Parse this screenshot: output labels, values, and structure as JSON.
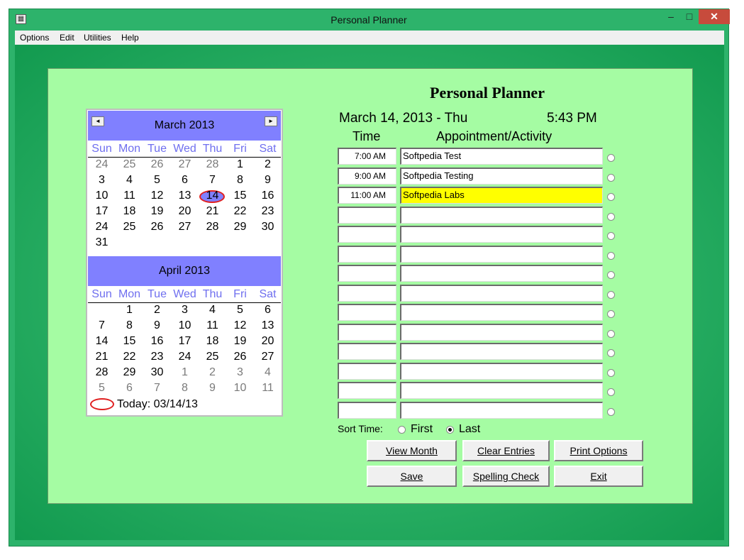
{
  "window": {
    "title": "Personal Planner",
    "icon": "planner-app-icon"
  },
  "menu": [
    "Options",
    "Edit",
    "Utilities",
    "Help"
  ],
  "planner": {
    "heading": "Personal Planner",
    "date": "March 14, 2013 - Thu",
    "time": "5:43 PM",
    "time_header": "Time",
    "activity_header": "Appointment/Activity"
  },
  "calendars": [
    {
      "title": "March 2013",
      "days_of_week": [
        "Sun",
        "Mon",
        "Tue",
        "Wed",
        "Thu",
        "Fri",
        "Sat"
      ],
      "weeks": [
        [
          "24",
          "25",
          "26",
          "27",
          "28",
          "1",
          "2"
        ],
        [
          "3",
          "4",
          "5",
          "6",
          "7",
          "8",
          "9"
        ],
        [
          "10",
          "11",
          "12",
          "13",
          "14",
          "15",
          "16"
        ],
        [
          "17",
          "18",
          "19",
          "20",
          "21",
          "22",
          "23"
        ],
        [
          "24",
          "25",
          "26",
          "27",
          "28",
          "29",
          "30"
        ],
        [
          "31",
          "",
          "",
          "",
          "",
          "",
          ""
        ]
      ],
      "selected_day": "14"
    },
    {
      "title": "April 2013",
      "days_of_week": [
        "Sun",
        "Mon",
        "Tue",
        "Wed",
        "Thu",
        "Fri",
        "Sat"
      ],
      "weeks": [
        [
          "",
          "1",
          "2",
          "3",
          "4",
          "5",
          "6"
        ],
        [
          "7",
          "8",
          "9",
          "10",
          "11",
          "12",
          "13"
        ],
        [
          "14",
          "15",
          "16",
          "17",
          "18",
          "19",
          "20"
        ],
        [
          "21",
          "22",
          "23",
          "24",
          "25",
          "26",
          "27"
        ],
        [
          "28",
          "29",
          "30",
          "1",
          "2",
          "3",
          "4"
        ],
        [
          "5",
          "6",
          "7",
          "8",
          "9",
          "10",
          "11"
        ]
      ]
    }
  ],
  "today_label": "Today: 03/14/13",
  "appointments": [
    {
      "time": "7:00 AM",
      "activity": "Softpedia Test",
      "highlight": false
    },
    {
      "time": "9:00 AM",
      "activity": "Softpedia Testing",
      "highlight": false
    },
    {
      "time": "11:00 AM",
      "activity": "Softpedia Labs",
      "highlight": true
    },
    {
      "time": "",
      "activity": "",
      "highlight": false
    },
    {
      "time": "",
      "activity": "",
      "highlight": false
    },
    {
      "time": "",
      "activity": "",
      "highlight": false
    },
    {
      "time": "",
      "activity": "",
      "highlight": false
    },
    {
      "time": "",
      "activity": "",
      "highlight": false
    },
    {
      "time": "",
      "activity": "",
      "highlight": false
    },
    {
      "time": "",
      "activity": "",
      "highlight": false
    },
    {
      "time": "",
      "activity": "",
      "highlight": false
    },
    {
      "time": "",
      "activity": "",
      "highlight": false
    },
    {
      "time": "",
      "activity": "",
      "highlight": false
    },
    {
      "time": "",
      "activity": "",
      "highlight": false
    }
  ],
  "sort": {
    "label": "Sort Time:",
    "first": "First",
    "last": "Last",
    "selected": "last"
  },
  "buttons": {
    "view_month": "View Month",
    "clear_entries": "Clear Entries",
    "print_options": "Print Options",
    "save": "Save",
    "spelling_check": "Spelling Check",
    "exit": "Exit"
  },
  "colors": {
    "panel": "#a5fca3",
    "calendar_header": "#8080ff",
    "highlight": "#ffff00",
    "window_bg": "#2db36b"
  }
}
